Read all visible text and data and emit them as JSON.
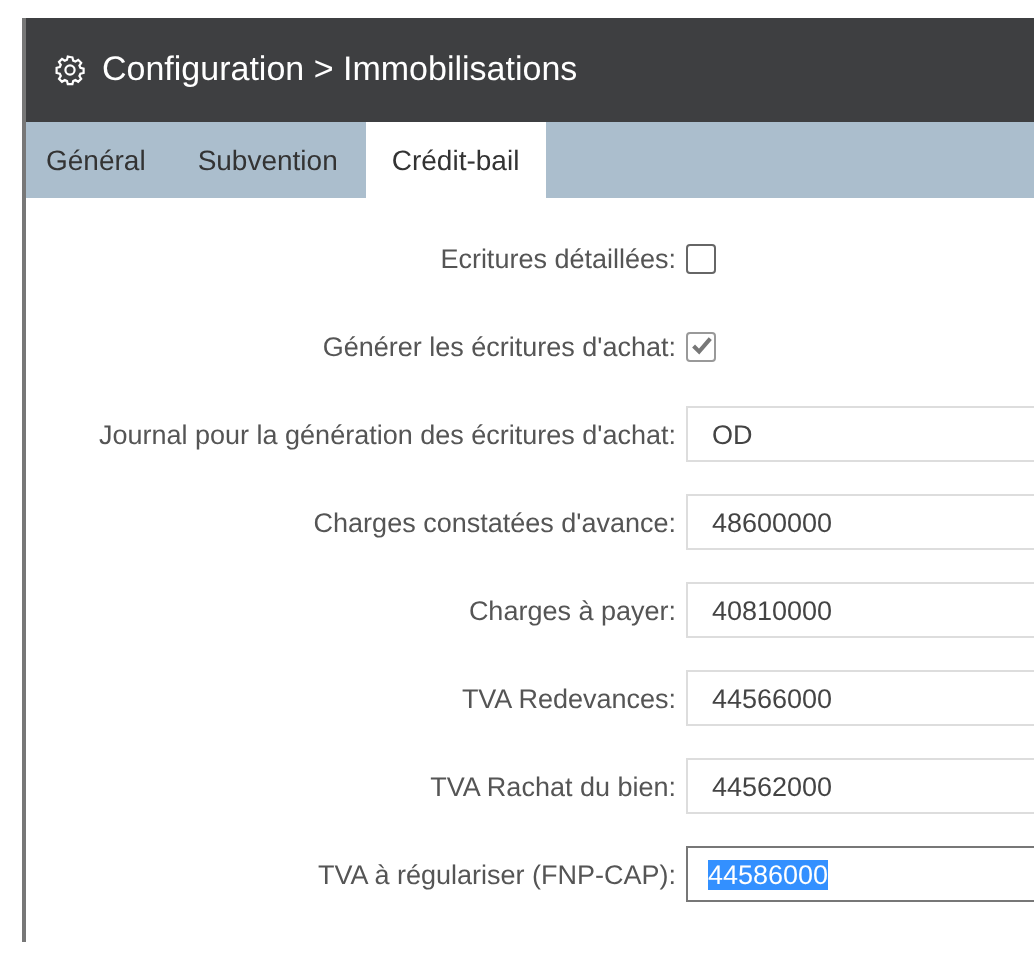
{
  "header": {
    "title": "Configuration > Immobilisations"
  },
  "tabs": [
    {
      "label": "Général",
      "selected": false
    },
    {
      "label": "Subvention",
      "selected": false
    },
    {
      "label": "Crédit-bail",
      "selected": true
    }
  ],
  "fields": [
    {
      "kind": "checkbox",
      "label": "Ecritures détaillées:",
      "checked": false
    },
    {
      "kind": "checkbox",
      "label": "Générer les écritures d'achat:",
      "checked": true
    },
    {
      "kind": "text",
      "label": "Journal pour la génération des écritures d'achat:",
      "value": "OD",
      "focused": false
    },
    {
      "kind": "text",
      "label": "Charges constatées d'avance:",
      "value": "48600000",
      "focused": false
    },
    {
      "kind": "text",
      "label": "Charges à payer:",
      "value": "40810000",
      "focused": false
    },
    {
      "kind": "text",
      "label": "TVA Redevances:",
      "value": "44566000",
      "focused": false
    },
    {
      "kind": "text",
      "label": "TVA Rachat du bien:",
      "value": "44562000",
      "focused": false
    },
    {
      "kind": "text",
      "label": "TVA à régulariser (FNP-CAP):",
      "value": "44586000",
      "focused": true
    }
  ]
}
